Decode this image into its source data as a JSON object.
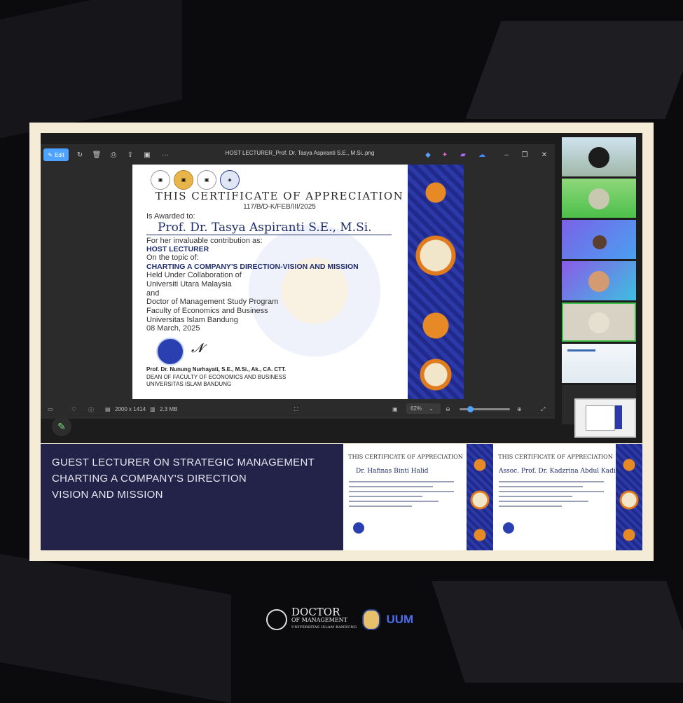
{
  "window": {
    "title": "HOST LECTURER_Prof. Dr. Tasya Aspiranti S.E., M.Si..png",
    "edit_label": "Edit",
    "dots_label": "···",
    "min_label": "–",
    "max_label": "❐",
    "close_label": "✕"
  },
  "certificate": {
    "title": "THIS CERTIFICATE OF APPRECIATION",
    "number": "117/B/D-K/FEB/III/2025",
    "awarded_to": "Is Awarded to:",
    "recipient": "Prof. Dr. Tasya Aspiranti S.E., M.Si.",
    "contribution": "For her invaluable contribution as:",
    "role": "HOST LECTURER",
    "topic_intro": "On the topic of:",
    "topic": "CHARTING A COMPANY'S DIRECTION-VISION AND MISSION",
    "held_under": "Held Under Collaboration of",
    "uni1": "Universiti Utara Malaysia",
    "and": "and",
    "program": "Doctor of Management Study Program",
    "faculty": "Faculty of Economics and Business",
    "uni2": "Universitas Islam Bandung",
    "date": "08 March, 2025",
    "signatory": "Prof. Dr. Nunung Nurhayati, S.E., M.Si., Ak., CA. CTT.",
    "signatory_title": "DEAN OF FACULTY OF ECONOMICS AND BUSINESS",
    "signatory_org": "UNIVERSITAS ISLAM BANDUNG"
  },
  "statusbar": {
    "dimensions": "2000 x 1414",
    "filesize": "2.3 MB",
    "zoom": "62%",
    "zoom_fraction": 0.15
  },
  "banner": {
    "line1": "GUEST LECTURER ON STRATEGIC MANAGEMENT",
    "line2": "CHARTING A COMPANY'S DIRECTION",
    "line3": "VISION AND MISSION"
  },
  "mini_certs": [
    {
      "title": "THIS CERTIFICATE OF APPRECIATION",
      "recipient": "Dr. Hafinas Binti Halid"
    },
    {
      "title": "THIS CERTIFICATE OF APPRECIATION",
      "recipient": "Assoc. Prof. Dr. Kadzrina Abdul Kadir"
    }
  ],
  "footer": {
    "doctor": "DOCTOR",
    "of_management": "OF MANAGEMENT",
    "subtitle": "UNIVERSITAS ISLAM BANDUNG",
    "uum": "UUM"
  },
  "colors": {
    "accent": "#4da3ff",
    "banner": "#23234a",
    "frame": "#f5ecd8",
    "active_speaker": "#3fbf4a"
  }
}
